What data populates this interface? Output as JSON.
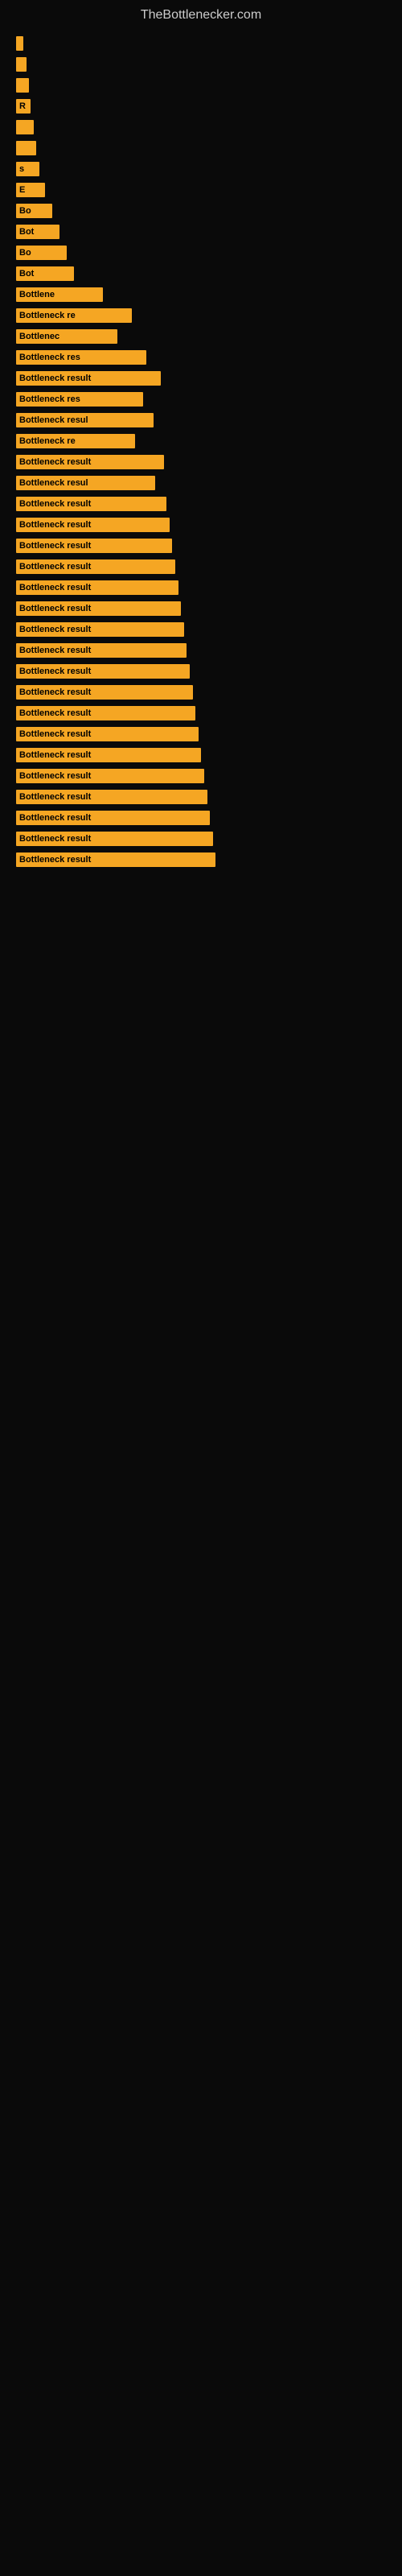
{
  "site": {
    "title": "TheBottlenecker.com"
  },
  "chart": {
    "bars": [
      {
        "label": "",
        "width": 5
      },
      {
        "label": "",
        "width": 7
      },
      {
        "label": "",
        "width": 9
      },
      {
        "label": "R",
        "width": 10
      },
      {
        "label": "",
        "width": 12
      },
      {
        "label": "",
        "width": 14
      },
      {
        "label": "s",
        "width": 16
      },
      {
        "label": "E",
        "width": 20
      },
      {
        "label": "Bo",
        "width": 25
      },
      {
        "label": "Bot",
        "width": 30
      },
      {
        "label": "Bo",
        "width": 35
      },
      {
        "label": "Bot",
        "width": 40
      },
      {
        "label": "Bottlene",
        "width": 60
      },
      {
        "label": "Bottleneck re",
        "width": 80
      },
      {
        "label": "Bottlenec",
        "width": 70
      },
      {
        "label": "Bottleneck res",
        "width": 90
      },
      {
        "label": "Bottleneck result",
        "width": 100
      },
      {
        "label": "Bottleneck res",
        "width": 88
      },
      {
        "label": "Bottleneck resul",
        "width": 95
      },
      {
        "label": "Bottleneck re",
        "width": 82
      },
      {
        "label": "Bottleneck result",
        "width": 102
      },
      {
        "label": "Bottleneck resul",
        "width": 96
      },
      {
        "label": "Bottleneck result",
        "width": 104
      },
      {
        "label": "Bottleneck result",
        "width": 106
      },
      {
        "label": "Bottleneck result",
        "width": 108
      },
      {
        "label": "Bottleneck result",
        "width": 110
      },
      {
        "label": "Bottleneck result",
        "width": 112
      },
      {
        "label": "Bottleneck result",
        "width": 114
      },
      {
        "label": "Bottleneck result",
        "width": 116
      },
      {
        "label": "Bottleneck result",
        "width": 118
      },
      {
        "label": "Bottleneck result",
        "width": 120
      },
      {
        "label": "Bottleneck result",
        "width": 122
      },
      {
        "label": "Bottleneck result",
        "width": 124
      },
      {
        "label": "Bottleneck result",
        "width": 126
      },
      {
        "label": "Bottleneck result",
        "width": 128
      },
      {
        "label": "Bottleneck result",
        "width": 130
      },
      {
        "label": "Bottleneck result",
        "width": 132
      },
      {
        "label": "Bottleneck result",
        "width": 134
      },
      {
        "label": "Bottleneck result",
        "width": 136
      },
      {
        "label": "Bottleneck result",
        "width": 138
      }
    ],
    "accent_color": "#f5a623",
    "bg_color": "#0a0a0a"
  }
}
